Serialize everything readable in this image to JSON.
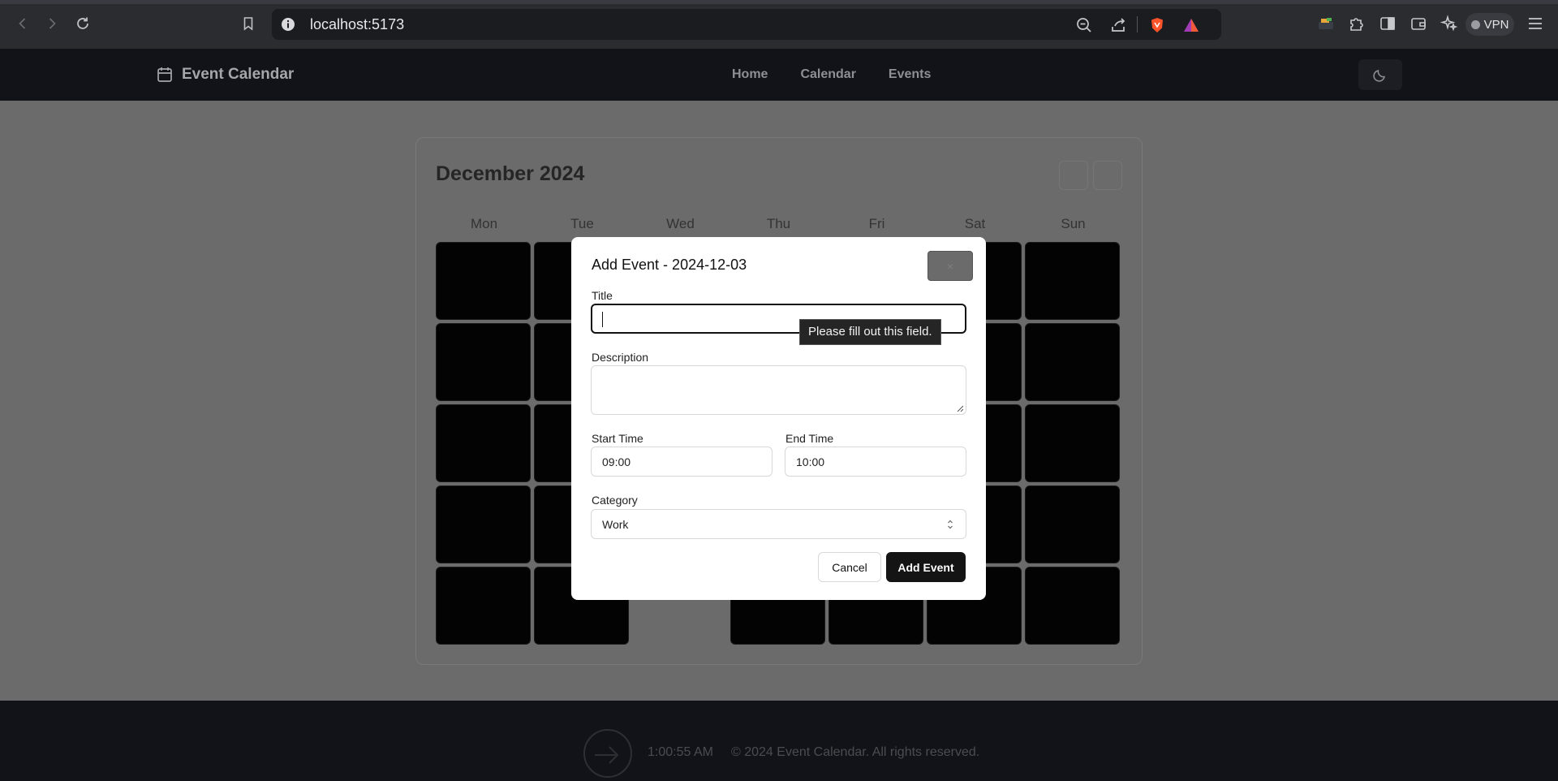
{
  "browser": {
    "url": "localhost:5173",
    "vpn_label": "VPN",
    "icons": [
      "back-icon",
      "forward-icon",
      "reload-icon",
      "bookmark-icon",
      "site-info-icon",
      "zoom-icon",
      "share-icon",
      "brave-shield-icon",
      "brave-rewards-icon",
      "extension-icon",
      "puzzle-icon",
      "sidebar-icon",
      "wallet-icon",
      "leo-ai-icon",
      "menu-icon"
    ]
  },
  "app": {
    "brand": "Event Calendar",
    "nav": [
      "Home",
      "Calendar",
      "Events"
    ],
    "calendar": {
      "month_title": "December 2024",
      "weekdays": [
        "Mon",
        "Tue",
        "Wed",
        "Thu",
        "Fri",
        "Sat",
        "Sun"
      ]
    },
    "footer": {
      "time": "1:00:55 AM",
      "copyright": "© 2024 Event Calendar. All rights reserved."
    }
  },
  "modal": {
    "title": "Add Event - 2024-12-03",
    "close_label": "×",
    "title_label": "Title",
    "title_value": "",
    "validation_tooltip": "Please fill out this field.",
    "description_label": "Description",
    "description_value": "",
    "start_label": "Start Time",
    "start_value": "09:00",
    "end_label": "End Time",
    "end_value": "10:00",
    "category_label": "Category",
    "category_value": "Work",
    "cancel_label": "Cancel",
    "submit_label": "Add Event"
  },
  "colors": {
    "overlay_dim": "#6b6b6b",
    "primary_button": "#141414",
    "header_bg": "#111318"
  }
}
